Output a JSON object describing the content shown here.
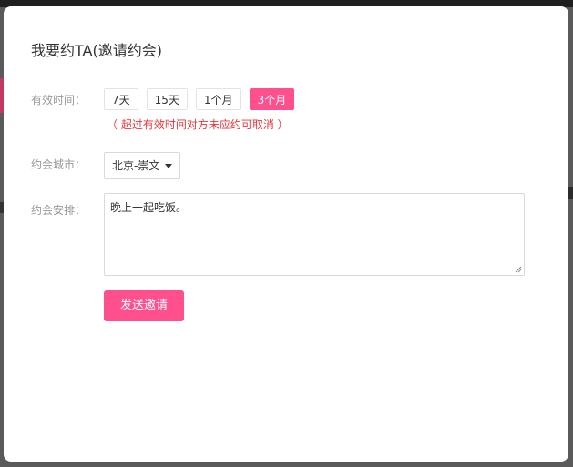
{
  "modal": {
    "title": "我要约TA(邀请约会)"
  },
  "duration": {
    "label": "有效时间：",
    "options": [
      "7天",
      "15天",
      "1个月",
      "3个月"
    ],
    "selected": "3个月",
    "hint": "（ 超过有效时间对方未应约可取消 ）"
  },
  "city": {
    "label": "约会城市：",
    "selected": "北京-崇文"
  },
  "plan": {
    "label": "约会安排：",
    "value": "晚上一起吃饭。"
  },
  "actions": {
    "send_label": "发送邀请"
  },
  "colors": {
    "accent": "#ff4f8c",
    "hint": "#e8363c",
    "label": "#999999"
  }
}
